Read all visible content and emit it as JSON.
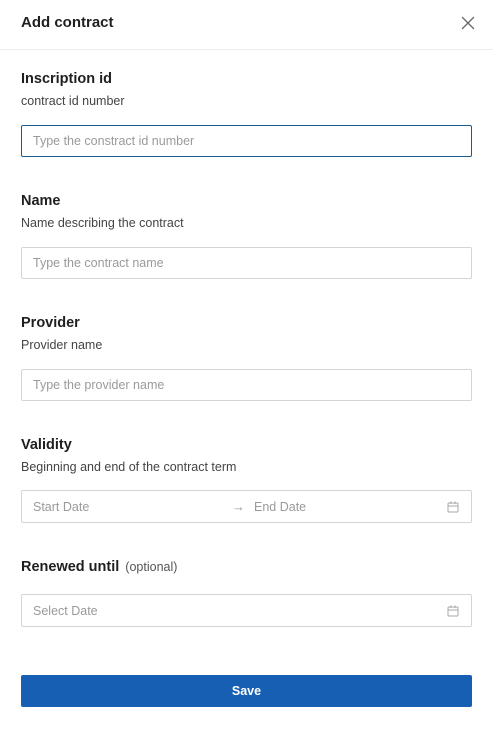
{
  "header": {
    "title": "Add contract",
    "close_icon": "close-icon"
  },
  "fields": {
    "inscription": {
      "label": "Inscription id",
      "description": "contract id number",
      "placeholder": "Type the constract id number",
      "value": ""
    },
    "name": {
      "label": "Name",
      "description": "Name describing the contract",
      "placeholder": "Type the contract name",
      "value": ""
    },
    "provider": {
      "label": "Provider",
      "description": "Provider name",
      "placeholder": "Type the provider name",
      "value": ""
    },
    "validity": {
      "label": "Validity",
      "description": "Beginning and end of the contract term",
      "start_placeholder": "Start Date",
      "end_placeholder": "End Date",
      "separator": "→",
      "icon": "calendar-icon"
    },
    "renewed": {
      "label": "Renewed until",
      "optional_label": "(optional)",
      "placeholder": "Select Date",
      "icon": "calendar-icon"
    }
  },
  "footer": {
    "save_label": "Save"
  },
  "colors": {
    "primary": "#175fb3",
    "focus_border": "#1d5c8f",
    "border": "#d4d4d4",
    "placeholder": "#9a9a9a"
  }
}
